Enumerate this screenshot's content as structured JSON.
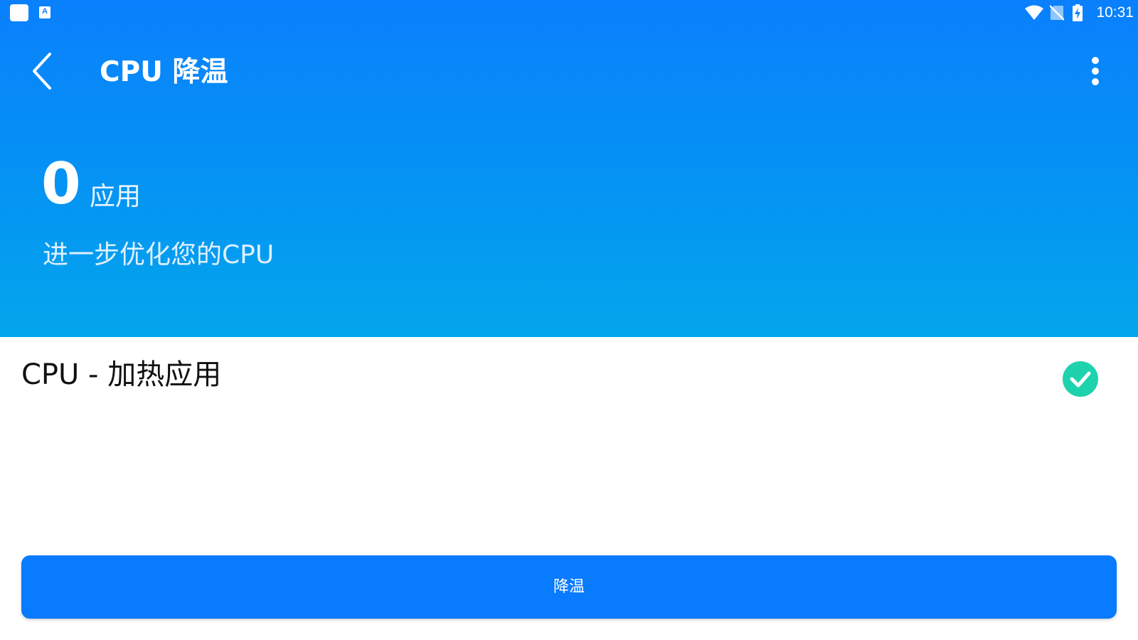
{
  "status_bar": {
    "time": "10:31",
    "app_icon_letter": "A",
    "icons": [
      "notification-square-icon",
      "app-a-icon",
      "wifi-icon",
      "no-sim-icon",
      "battery-charging-icon"
    ]
  },
  "toolbar": {
    "title": "CPU 降温",
    "back_icon": "chevron-left-icon",
    "more_icon": "more-vertical-icon"
  },
  "summary": {
    "count": "0",
    "unit": "应用",
    "subtitle": "进一步优化您的CPU"
  },
  "section": {
    "title": "CPU - 加热应用",
    "check_icon": "check-circle-icon",
    "checked": true
  },
  "action": {
    "label": "降温"
  },
  "colors": {
    "header_top": "#0a80fd",
    "header_bottom": "#04a6ec",
    "check_green": "#1ed2ad",
    "button_blue": "#087bfe"
  }
}
